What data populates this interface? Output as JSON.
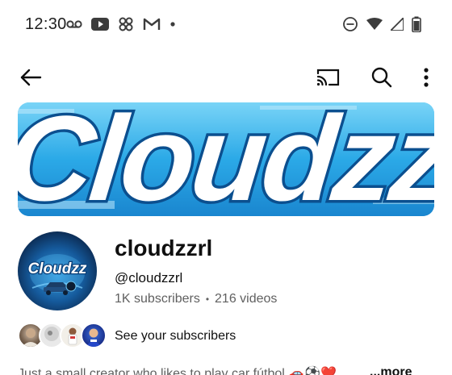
{
  "status_bar": {
    "time": "12:30",
    "left_icons": [
      "voicemail-icon",
      "youtube-icon",
      "pinwheel-icon",
      "gmail-icon",
      "notification-dot-icon"
    ],
    "right_icons": [
      "do-not-disturb-icon",
      "wifi-icon",
      "signal-icon",
      "battery-icon"
    ]
  },
  "app_bar": {
    "icons": [
      "back-arrow-icon",
      "cast-icon",
      "search-icon",
      "more-vert-icon"
    ]
  },
  "banner": {
    "text": "Cloudzz",
    "colors": {
      "sky": "#2aa8e6",
      "text_fill": "#ffffff",
      "text_outline": "#0b4f8f"
    }
  },
  "channel": {
    "avatar_text": "Cloudzz",
    "name": "cloudzzrl",
    "handle": "@cloudzzrl",
    "subscribers": "1K subscribers",
    "separator": "•",
    "videos": "216 videos"
  },
  "subscribers_row": {
    "label": "See your subscribers",
    "avatar_count": 4
  },
  "description": {
    "text": "Just a small creator who likes to play car fútbol 🚗⚽❤️",
    "more_label": "...more"
  }
}
